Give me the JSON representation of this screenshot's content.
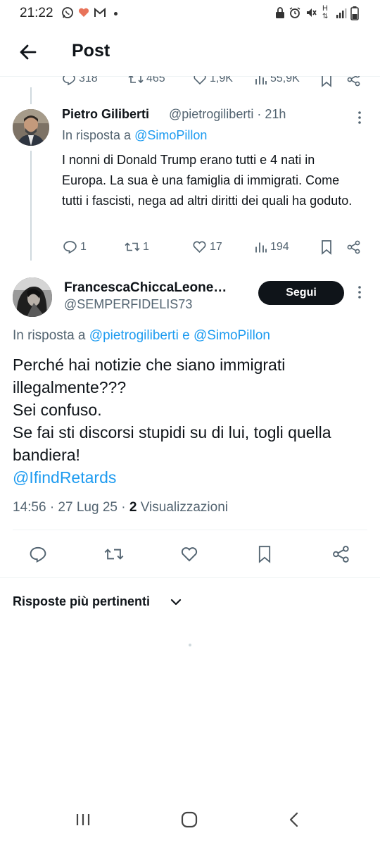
{
  "status_bar": {
    "time": "21:22",
    "icons": [
      "whatsapp-icon",
      "heart-app-icon",
      "gmail-icon",
      "dot-icon",
      "lock-icon",
      "alarm-icon",
      "mute-icon",
      "signal-h-icon",
      "signal-bars-icon",
      "battery-icon"
    ],
    "network_label": "H"
  },
  "header": {
    "title": "Post"
  },
  "previous_tweet_actions": {
    "replies": "318",
    "reposts": "465",
    "likes": "1,9K",
    "views": "55,9K"
  },
  "tweet_1": {
    "author_name": "Pietro Giliberti",
    "handle": "@pietrogiliberti",
    "time": "· 21h",
    "reply_prefix": "In risposta a",
    "reply_to": "@SimoPillon",
    "text": "I nonni di Donald Trump erano tutti e 4 nati in Europa. La sua è una famiglia di immigrati. Come tutti i fascisti, nega ad altri diritti dei quali ha goduto.",
    "replies": "1",
    "reposts": "1",
    "likes": "17",
    "views": "194"
  },
  "tweet_2": {
    "author_name": "FrancescaChiccaLeone…",
    "handle": "@SEMPERFIDELIS73",
    "follow_label": "Segui",
    "reply_prefix": "In risposta a",
    "reply_to_1": "@pietrogiliberti",
    "reply_joiner": "e",
    "reply_to_2": "@SimoPillon",
    "text_lines": [
      "Perché hai notizie che siano immigrati illegalmente???",
      "Sei confuso.",
      "Se fai sti discorsi stupidi su di lui, togli quella bandiera!"
    ],
    "mention": "@IfindRetards",
    "timestamp": "14:56 · 27 Lug 25 ·",
    "views_count": "2",
    "views_label": "Visualizzazioni"
  },
  "replies_section": {
    "sort_label": "Risposte più pertinenti"
  },
  "colors": {
    "accent": "#1d9bf0",
    "text": "#0f1419",
    "secondary": "#536471",
    "border": "#eff3f4"
  }
}
